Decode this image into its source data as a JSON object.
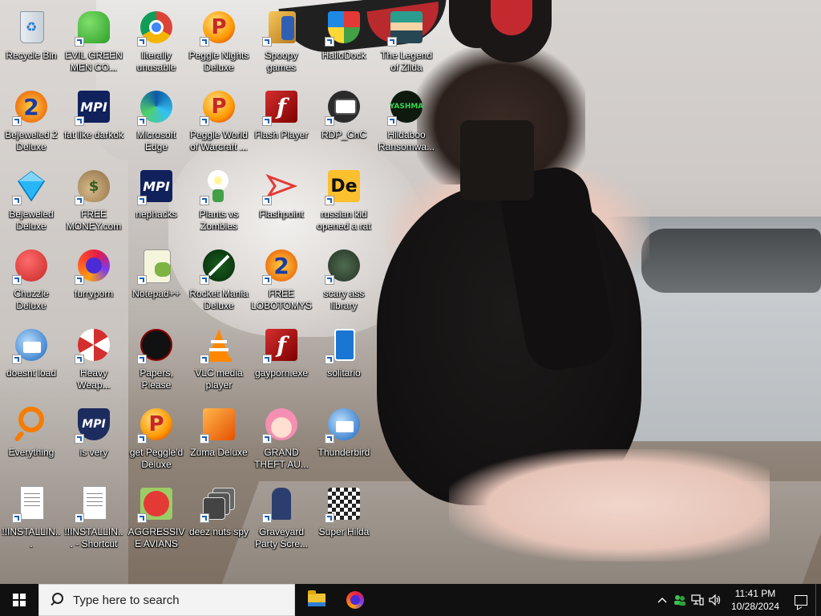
{
  "desktop": {
    "icons": [
      {
        "label": "Recycle Bin",
        "icon": "recycle-bin-icon"
      },
      {
        "label": "EVIL GREEN MEN CO...",
        "icon": "green-people-icon"
      },
      {
        "label": "literally unusable",
        "icon": "chrome-icon"
      },
      {
        "label": "Peggle Nights Deluxe",
        "icon": "peggle-icon"
      },
      {
        "label": "Spoopy games",
        "icon": "games-folder-icon"
      },
      {
        "label": "HalloDock",
        "icon": "windows-shield-icon"
      },
      {
        "label": "The Legend of Zilda",
        "icon": "pixel-hero-icon"
      },
      {
        "label": "Bejeweled 2 Deluxe",
        "icon": "bejeweled2-icon"
      },
      {
        "label": "fat like darkok",
        "icon": "mpi-icon"
      },
      {
        "label": "Microsoft Edge",
        "icon": "edge-icon"
      },
      {
        "label": "Peggle World of Warcraft ...",
        "icon": "peggle-icon"
      },
      {
        "label": "Flash Player",
        "icon": "flash-icon"
      },
      {
        "label": "RDP_CnC",
        "icon": "rdp-icon"
      },
      {
        "label": "Hildaboo Ransomwa...",
        "icon": "yashma-icon"
      },
      {
        "label": "Bejeweled Deluxe",
        "icon": "diamond-icon"
      },
      {
        "label": "FREE MONEY.com",
        "icon": "money-bag-icon"
      },
      {
        "label": "nephacks",
        "icon": "mpi-icon"
      },
      {
        "label": "Plants vs Zombies",
        "icon": "flower-icon"
      },
      {
        "label": "Flashpoint",
        "icon": "flashpoint-icon"
      },
      {
        "label": "russian kid opened a rat",
        "icon": "de-icon"
      },
      {
        "label": "Chuzzle Deluxe",
        "icon": "chuzzle-icon"
      },
      {
        "label": "furryporn",
        "icon": "firefox-icon"
      },
      {
        "label": "Notepad++",
        "icon": "notepad-icon"
      },
      {
        "label": "Rocket Mania Deluxe",
        "icon": "rocket-icon"
      },
      {
        "label": "FREE LOBOTOMYS",
        "icon": "bejeweled2-icon"
      },
      {
        "label": "scary ass library",
        "icon": "library-icon"
      },
      {
        "label": "doesnt load",
        "icon": "thunderbird-icon"
      },
      {
        "label": "Heavy Weap...",
        "icon": "radiation-icon"
      },
      {
        "label": "Papers, Please",
        "icon": "papers-please-icon"
      },
      {
        "label": "VLC media player",
        "icon": "vlc-icon"
      },
      {
        "label": "gayporn.exe",
        "icon": "flash-icon"
      },
      {
        "label": "solitario",
        "icon": "solitaire-icon"
      },
      {
        "label": "Everything",
        "icon": "search-loupe-icon"
      },
      {
        "label": "is very",
        "icon": "mpi-shield-icon"
      },
      {
        "label": "get Peggle'd Deluxe",
        "icon": "peggle-icon"
      },
      {
        "label": "Zuma Deluxe",
        "icon": "zuma-icon"
      },
      {
        "label": "GRAND THEFT AU...",
        "icon": "anime-girl-icon"
      },
      {
        "label": "Thunderbird",
        "icon": "thunderbird-icon"
      },
      {
        "label": "!!INSTALLIN...",
        "icon": "text-file-icon"
      },
      {
        "label": "!!INSTALLIN... - Shortcut",
        "icon": "text-file-icon"
      },
      {
        "label": "AGGRESSIVE AVIANS",
        "icon": "angry-bird-icon"
      },
      {
        "label": "deez nuts spy",
        "icon": "stacked-windows-icon"
      },
      {
        "label": "Graveyard Party Scre...",
        "icon": "graveyard-icon"
      },
      {
        "label": "Super Hilda",
        "icon": "pixel-map-icon"
      }
    ]
  },
  "taskbar": {
    "search_placeholder": "Type here to search",
    "pinned": [
      {
        "name": "File Explorer",
        "icon": "folder-icon"
      },
      {
        "name": "Firefox",
        "icon": "firefox-icon"
      }
    ],
    "tray": {
      "chevron": "^",
      "time": "11:41 PM",
      "date": "10/28/2024"
    }
  }
}
